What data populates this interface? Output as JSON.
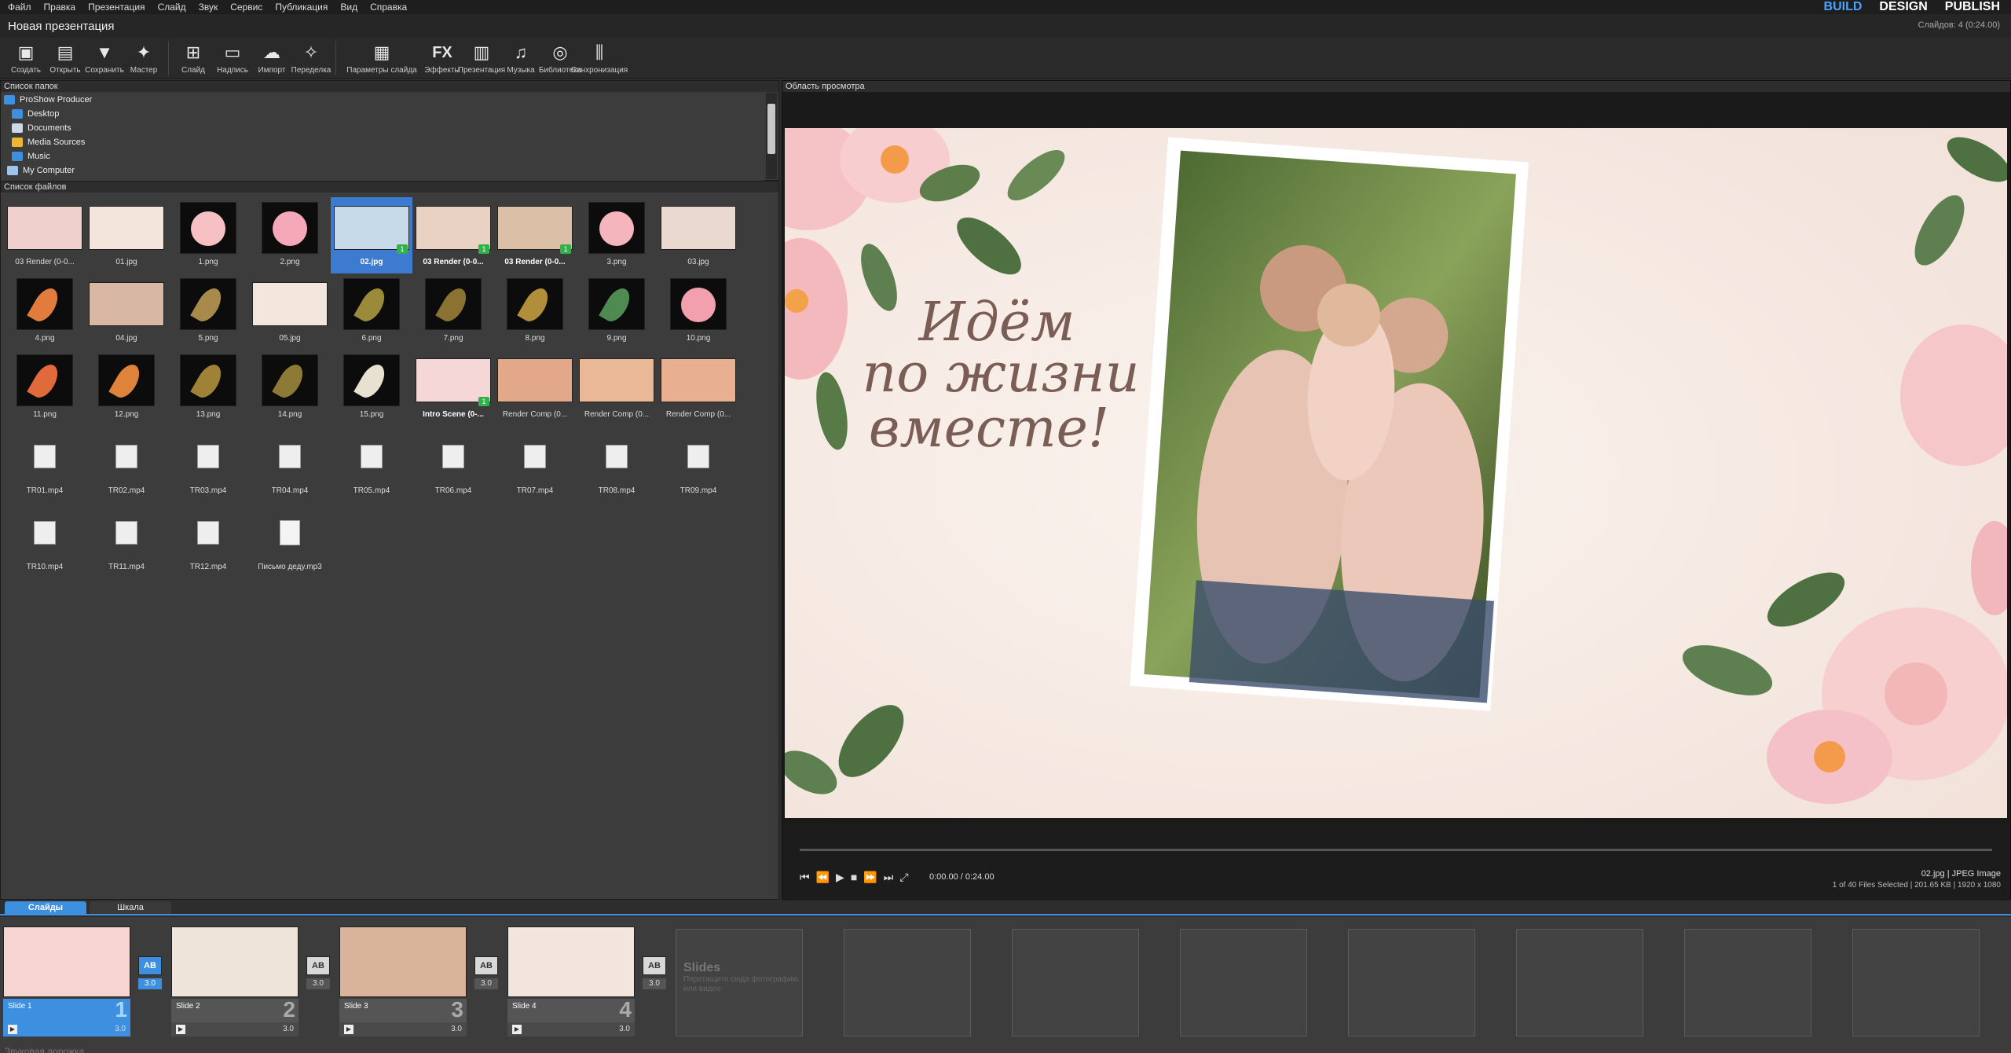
{
  "menu": [
    "Файл",
    "Правка",
    "Презентация",
    "Слайд",
    "Звук",
    "Сервис",
    "Публикация",
    "Вид",
    "Справка"
  ],
  "modes": {
    "build": "BUILD",
    "design": "DESIGN",
    "publish": "PUBLISH"
  },
  "window_title": "Новая презентация",
  "slide_count": "Слайдов: 4 (0:24.00)",
  "toolbar": [
    {
      "label": "Создать",
      "icon": "create-icon",
      "glyph": "▣"
    },
    {
      "label": "Открыть",
      "icon": "open-icon",
      "glyph": "▤"
    },
    {
      "label": "Сохранить",
      "icon": "save-icon",
      "glyph": "▼"
    },
    {
      "label": "Мастер",
      "icon": "wizard-icon",
      "glyph": "✦"
    },
    {
      "label": "Слайд",
      "icon": "slide-icon",
      "glyph": "⊞"
    },
    {
      "label": "Надпись",
      "icon": "caption-icon",
      "glyph": "▭"
    },
    {
      "label": "Импорт",
      "icon": "import-icon",
      "glyph": "☁"
    },
    {
      "label": "Переделка",
      "icon": "remix-icon",
      "glyph": "✧"
    },
    {
      "label": "Параметры слайда",
      "icon": "slide-options-icon",
      "glyph": "▦"
    },
    {
      "label": "Эффекты",
      "icon": "effects-icon",
      "glyph": "FX"
    },
    {
      "label": "Презентация",
      "icon": "show-options-icon",
      "glyph": "▥"
    },
    {
      "label": "Музыка",
      "icon": "music-icon",
      "glyph": "♫"
    },
    {
      "label": "Библиотека",
      "icon": "library-icon",
      "glyph": "◎"
    },
    {
      "label": "Синхронизация",
      "icon": "sync-icon",
      "glyph": "⫼"
    }
  ],
  "folder_panel": {
    "title": "Список папок",
    "items": [
      {
        "label": "ProShow Producer",
        "color": "#3d8fe0",
        "indent": 4
      },
      {
        "label": "Desktop",
        "color": "#3d8fe0",
        "indent": 14
      },
      {
        "label": "Documents",
        "color": "#cfd8e6",
        "indent": 14
      },
      {
        "label": "Media Sources",
        "color": "#f0b530",
        "indent": 14
      },
      {
        "label": "Music",
        "color": "#3d8fe0",
        "indent": 14
      },
      {
        "label": "My Computer",
        "color": "#9ec4ee",
        "indent": 8
      }
    ]
  },
  "file_panel": {
    "title": "Список файлов",
    "files": [
      {
        "name": "03 Render (0-0...",
        "kind": "photo",
        "bg": "#f0d0cc",
        "badge": ""
      },
      {
        "name": "01.jpg",
        "kind": "photo",
        "bg": "#f3e4dc",
        "badge": ""
      },
      {
        "name": "1.png",
        "kind": "flower",
        "bg": "#f7c1c4",
        "badge": ""
      },
      {
        "name": "2.png",
        "kind": "flower",
        "bg": "#f4a8b8",
        "badge": ""
      },
      {
        "name": "02.jpg",
        "kind": "photo",
        "bg": "#c6d9e8",
        "badge": "1",
        "selected": true
      },
      {
        "name": "03 Render (0-0...",
        "kind": "photo",
        "bg": "#e9d2c4",
        "badge": "1",
        "bold": true
      },
      {
        "name": "03 Render (0-0...",
        "kind": "photo",
        "bg": "#dcbfa7",
        "badge": "1",
        "bold": true
      },
      {
        "name": "3.png",
        "kind": "flower",
        "bg": "#f5b5bd",
        "badge": ""
      },
      {
        "name": "03.jpg",
        "kind": "photo",
        "bg": "#ead9cf",
        "badge": ""
      },
      {
        "name": "4.png",
        "kind": "leaf",
        "bg": "#e27b3e",
        "badge": ""
      },
      {
        "name": "04.jpg",
        "kind": "photo",
        "bg": "#d8b8a4",
        "badge": ""
      },
      {
        "name": "5.png",
        "kind": "leaf",
        "bg": "#a88b4a",
        "badge": ""
      },
      {
        "name": "05.jpg",
        "kind": "photo",
        "bg": "#f2e6dd",
        "badge": ""
      },
      {
        "name": "6.png",
        "kind": "leaf",
        "bg": "#9a8a3a",
        "badge": ""
      },
      {
        "name": "7.png",
        "kind": "leaf",
        "bg": "#8a7332",
        "badge": ""
      },
      {
        "name": "8.png",
        "kind": "leaf",
        "bg": "#b08e3a",
        "badge": ""
      },
      {
        "name": "9.png",
        "kind": "leaf",
        "bg": "#4f8a52",
        "badge": ""
      },
      {
        "name": "10.png",
        "kind": "flower",
        "bg": "#f3a0ae",
        "badge": ""
      },
      {
        "name": "11.png",
        "kind": "leaf",
        "bg": "#e06a3a",
        "badge": ""
      },
      {
        "name": "12.png",
        "kind": "leaf",
        "bg": "#e0833a",
        "badge": ""
      },
      {
        "name": "13.png",
        "kind": "leaf",
        "bg": "#a08236",
        "badge": ""
      },
      {
        "name": "14.png",
        "kind": "leaf",
        "bg": "#8c7a36",
        "badge": ""
      },
      {
        "name": "15.png",
        "kind": "leaf",
        "bg": "#e8e0d0",
        "badge": ""
      },
      {
        "name": "Intro Scene (0-...",
        "kind": "photo",
        "bg": "#f4d7d6",
        "badge": "1",
        "bold": true
      },
      {
        "name": "Render Comp (0...",
        "kind": "photo",
        "bg": "#e3a889",
        "badge": ""
      },
      {
        "name": "Render Comp (0...",
        "kind": "photo",
        "bg": "#e8b897",
        "badge": ""
      },
      {
        "name": "Render Comp (0...",
        "kind": "photo",
        "bg": "#e8b090",
        "badge": ""
      },
      {
        "name": "TR01.mp4",
        "kind": "video",
        "bg": "",
        "badge": ""
      },
      {
        "name": "TR02.mp4",
        "kind": "video",
        "bg": "",
        "badge": ""
      },
      {
        "name": "TR03.mp4",
        "kind": "video",
        "bg": "",
        "badge": ""
      },
      {
        "name": "TR04.mp4",
        "kind": "video",
        "bg": "",
        "badge": ""
      },
      {
        "name": "TR05.mp4",
        "kind": "video",
        "bg": "",
        "badge": ""
      },
      {
        "name": "TR06.mp4",
        "kind": "video",
        "bg": "",
        "badge": ""
      },
      {
        "name": "TR07.mp4",
        "kind": "video",
        "bg": "",
        "badge": ""
      },
      {
        "name": "TR08.mp4",
        "kind": "video",
        "bg": "",
        "badge": ""
      },
      {
        "name": "TR09.mp4",
        "kind": "video",
        "bg": "",
        "badge": ""
      },
      {
        "name": "TR10.mp4",
        "kind": "video",
        "bg": "",
        "badge": ""
      },
      {
        "name": "TR11.mp4",
        "kind": "video",
        "bg": "",
        "badge": ""
      },
      {
        "name": "TR12.mp4",
        "kind": "video",
        "bg": "",
        "badge": ""
      },
      {
        "name": "Письмо деду.mp3",
        "kind": "audio",
        "bg": "",
        "badge": ""
      }
    ]
  },
  "preview": {
    "title": "Область просмотра",
    "text_line1": "Идём",
    "text_line2": "по жизни",
    "text_line3": "вместе!",
    "timecode": "0:00.00 / 0:24.00",
    "file_line1": "02.jpg  |  JPEG Image",
    "file_line2": "1 of 40 Files Selected  |  201.65 KB  |  1920 x 1080",
    "controls": [
      "⏮",
      "⏪",
      "▶",
      "■",
      "⏩",
      "⏭",
      "⤢"
    ]
  },
  "tabs": {
    "slides": "Слайды",
    "timeline": "Шкала"
  },
  "slides": [
    {
      "name": "Slide 1",
      "num": "1",
      "duration": "3.0",
      "bg": "#f6d4d2",
      "active": true
    },
    {
      "name": "Slide 2",
      "num": "2",
      "duration": "3.0",
      "bg": "#efe4da",
      "active": false
    },
    {
      "name": "Slide 3",
      "num": "3",
      "duration": "3.0",
      "bg": "#d9b49a",
      "active": false
    },
    {
      "name": "Slide 4",
      "num": "4",
      "duration": "3.0",
      "bg": "#f1e5dd",
      "active": false
    }
  ],
  "transitions": [
    {
      "label": "AB",
      "duration": "3.0",
      "active": true
    },
    {
      "label": "AB",
      "duration": "3.0",
      "active": false
    },
    {
      "label": "AB",
      "duration": "3.0",
      "active": false
    },
    {
      "label": "AB",
      "duration": "3.0",
      "active": false
    }
  ],
  "empty_hint": {
    "title": "Slides",
    "text": "Перетащите сюда фотографию или видео"
  },
  "bottom_partial": "Звуковая дорожка"
}
